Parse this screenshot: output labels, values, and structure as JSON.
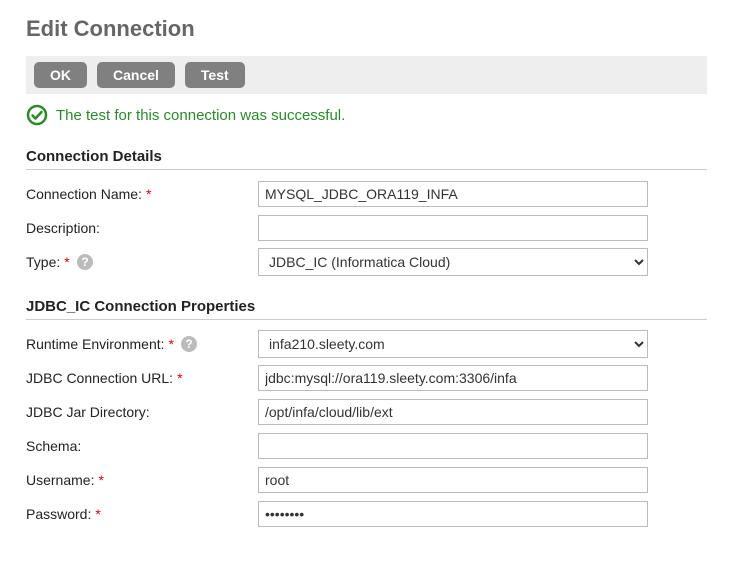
{
  "title": "Edit Connection",
  "buttons": {
    "ok": "OK",
    "cancel": "Cancel",
    "test": "Test"
  },
  "status": {
    "message": "The test for this connection was successful.",
    "color": "#2a8a2a"
  },
  "sections": {
    "details": "Connection Details",
    "jdbc": "JDBC_IC Connection Properties"
  },
  "labels": {
    "connection_name": "Connection Name:",
    "description": "Description:",
    "type": "Type:",
    "runtime_env": "Runtime Environment:",
    "jdbc_url": "JDBC Connection URL:",
    "jdbc_jar": "JDBC Jar Directory:",
    "schema": "Schema:",
    "username": "Username:",
    "password": "Password:"
  },
  "values": {
    "connection_name": "MYSQL_JDBC_ORA119_INFA",
    "description": "",
    "type": "JDBC_IC (Informatica Cloud)",
    "runtime_env": "infa210.sleety.com",
    "jdbc_url": "jdbc:mysql://ora119.sleety.com:3306/infa",
    "jdbc_jar": "/opt/infa/cloud/lib/ext",
    "schema": "",
    "username": "root",
    "password": "••••••••"
  },
  "required_marker": "*"
}
